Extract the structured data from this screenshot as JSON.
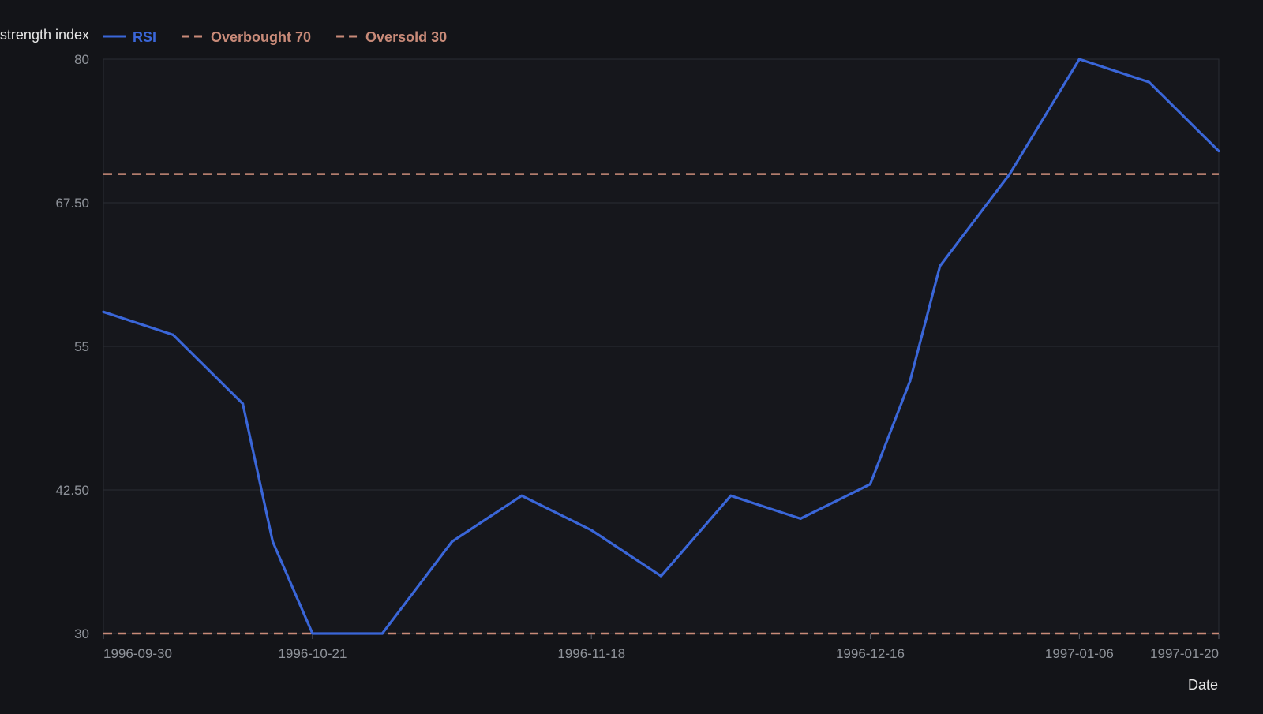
{
  "chart_data": {
    "type": "line",
    "title": "",
    "ylabel": "Relative strength index",
    "xlabel": "Date",
    "ylim": [
      30,
      80
    ],
    "y_ticks": [
      "30",
      "42.50",
      "55",
      "67.50",
      "80"
    ],
    "y_tick_values": [
      30,
      42.5,
      55,
      67.5,
      80
    ],
    "x_ticks": [
      "1996-09-30",
      "1996-10-21",
      "1996-11-18",
      "1996-12-16",
      "1997-01-06",
      "1997-01-20"
    ],
    "grid": true,
    "legend_position": "top-left",
    "x": [
      "1996-09-30",
      "1996-10-07",
      "1996-10-14",
      "1996-10-17",
      "1996-10-21",
      "1996-10-28",
      "1996-11-04",
      "1996-11-11",
      "1996-11-18",
      "1996-11-25",
      "1996-12-02",
      "1996-12-09",
      "1996-12-16",
      "1996-12-20",
      "1996-12-23",
      "1996-12-30",
      "1997-01-06",
      "1997-01-13",
      "1997-01-20"
    ],
    "series": [
      {
        "name": "RSI",
        "color": "#3a66d8",
        "style": "solid",
        "values": [
          58.0,
          56.0,
          50.0,
          38.0,
          30.0,
          30.0,
          38.0,
          42.0,
          39.0,
          35.0,
          42.0,
          40.0,
          43.0,
          52.0,
          62.0,
          70.0,
          80.0,
          78.0,
          72.0
        ]
      },
      {
        "name": "Overbought 70",
        "color": "#c88a78",
        "style": "dashed",
        "level": 70
      },
      {
        "name": "Oversold 30",
        "color": "#c88a78",
        "style": "dashed",
        "level": 30
      }
    ]
  },
  "colors": {
    "background": "#131418",
    "plot_background": "#16171c",
    "grid": "#2a2c33",
    "tick_text": "#8f939a",
    "axis_title": "#e6e6e6"
  }
}
